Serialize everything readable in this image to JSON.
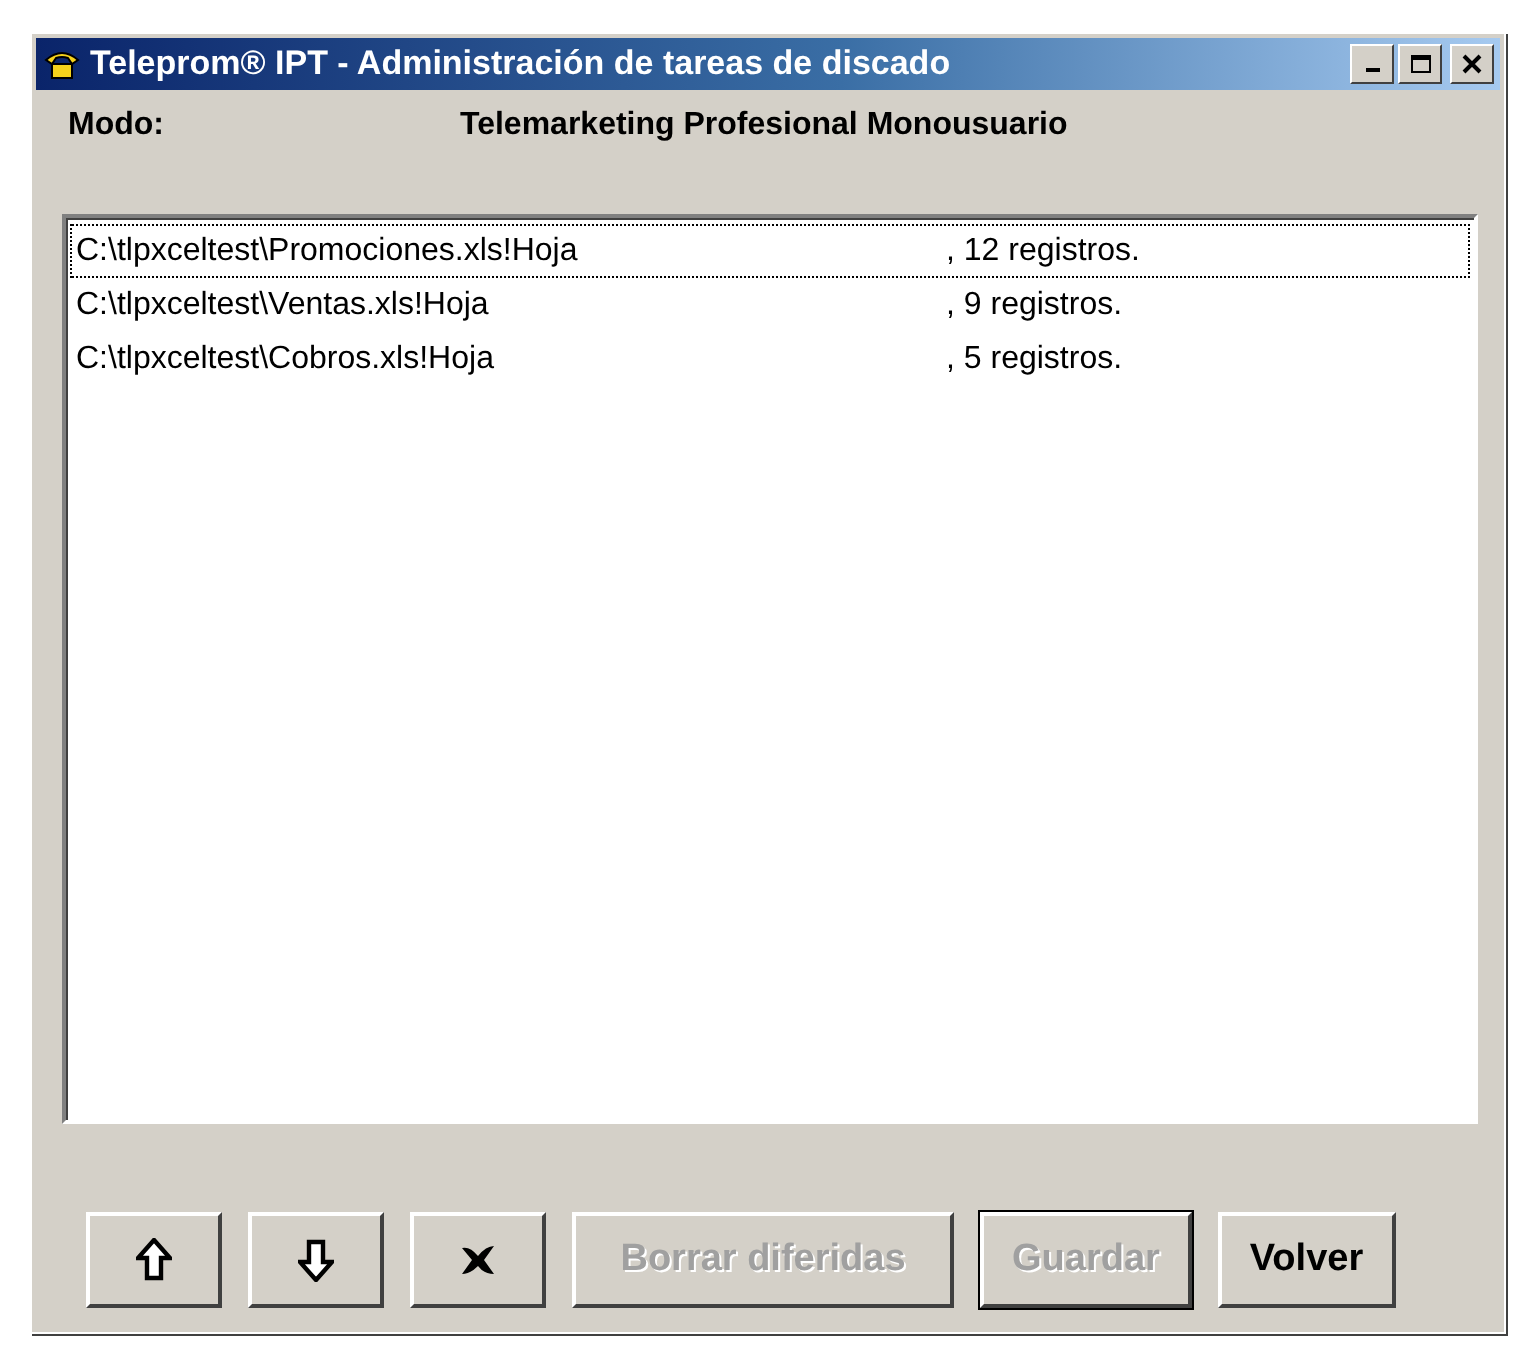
{
  "window": {
    "title": "Teleprom® IPT - Administración de tareas de discado"
  },
  "mode": {
    "label": "Modo:",
    "value": "Telemarketing Profesional Monousuario"
  },
  "tasks": [
    {
      "path": "C:\\tlpxceltest\\Promociones.xls!Hoja",
      "count": ", 12 registros.",
      "selected": true
    },
    {
      "path": "C:\\tlpxceltest\\Ventas.xls!Hoja",
      "count": ", 9 registros.",
      "selected": false
    },
    {
      "path": "C:\\tlpxceltest\\Cobros.xls!Hoja",
      "count": ", 5 registros.",
      "selected": false
    }
  ],
  "buttons": [
    {
      "kind": "up",
      "disabled": false,
      "default": false
    },
    {
      "kind": "down",
      "disabled": false,
      "default": false
    },
    {
      "kind": "delete",
      "disabled": false,
      "default": false
    },
    {
      "kind": "text",
      "label": "Borrar diferidas",
      "disabled": true,
      "default": false
    },
    {
      "kind": "text",
      "label": "Guardar",
      "disabled": true,
      "default": true
    },
    {
      "kind": "text",
      "label": "Volver",
      "disabled": false,
      "default": false
    }
  ]
}
